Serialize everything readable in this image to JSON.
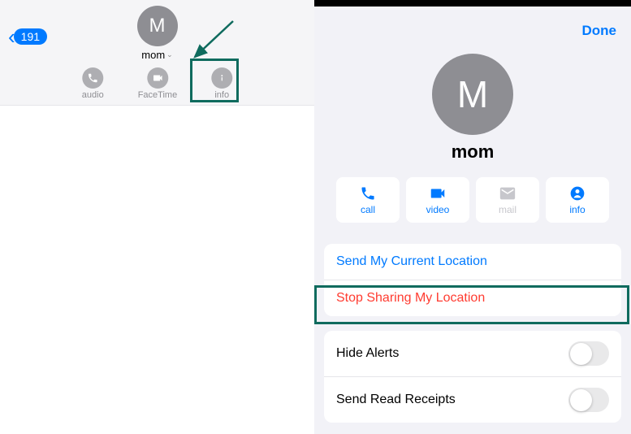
{
  "left": {
    "back_count": "191",
    "avatar_initial": "M",
    "contact_name": "mom",
    "actions": {
      "audio": "audio",
      "facetime": "FaceTime",
      "info": "info"
    }
  },
  "right": {
    "done": "Done",
    "avatar_initial": "M",
    "contact_name": "mom",
    "quick": {
      "call": "call",
      "video": "video",
      "mail": "mail",
      "info": "info"
    },
    "rows": {
      "send_location": "Send My Current Location",
      "stop_sharing": "Stop Sharing My Location",
      "hide_alerts": "Hide Alerts",
      "read_receipts": "Send Read Receipts"
    }
  }
}
